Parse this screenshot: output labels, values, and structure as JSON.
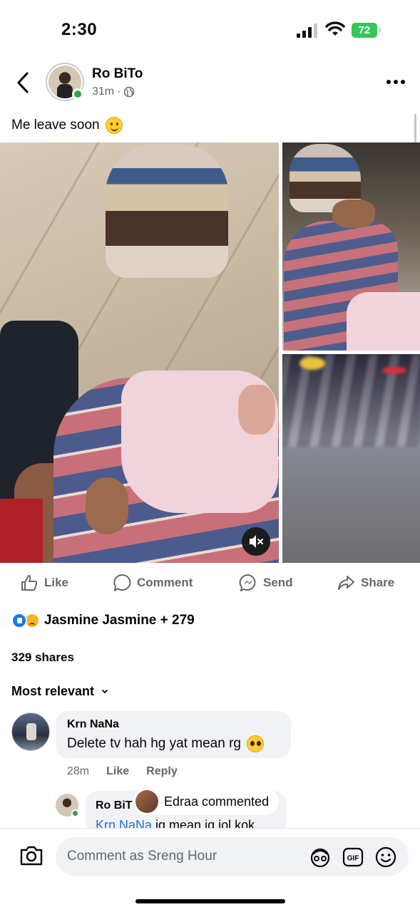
{
  "status_bar": {
    "time": "2:30",
    "battery": "72"
  },
  "post": {
    "author": "Ro BiTo",
    "time": "31m",
    "visibility": "public",
    "caption": "Me leave soon"
  },
  "actions": {
    "like": "Like",
    "comment": "Comment",
    "send": "Send",
    "share": "Share"
  },
  "reactions": {
    "summary": "Jasmine Jasmine + 279"
  },
  "shares": "329 shares",
  "sort_label": "Most relevant",
  "comments": [
    {
      "author": "Krn NaNa",
      "text": "Delete tv hah hg yat mean rg",
      "time": "28m",
      "like": "Like",
      "reply": "Reply"
    }
  ],
  "reply": {
    "author": "Ro BiT",
    "mention": "Krn NaNa",
    "text": " ig mean ig iol kok"
  },
  "toast": {
    "text": "Edraa commented"
  },
  "comment_bar": {
    "placeholder": "Comment as Sreng Hour"
  },
  "colors": {
    "accent": "#1877f2",
    "online": "#31a24c",
    "battery": "#34c759",
    "muted_text": "#65676b"
  }
}
